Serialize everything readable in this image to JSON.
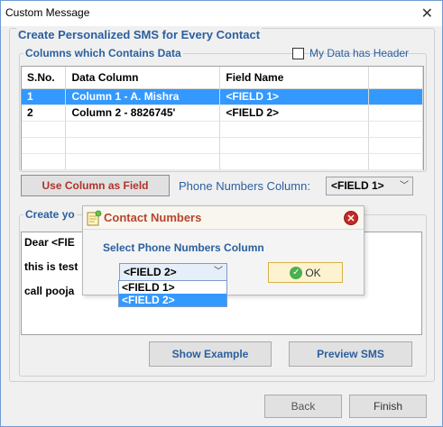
{
  "window": {
    "title": "Custom Message",
    "close_glyph": "✕"
  },
  "main_group": {
    "legend": "Create Personalized SMS for Every Contact"
  },
  "columns_group": {
    "legend": "Columns which Contains Data",
    "header_checkbox_label": "My Data has Header",
    "header_checked": false,
    "table": {
      "headers": [
        "S.No.",
        "Data Column",
        "Field Name"
      ],
      "rows": [
        {
          "sno": "1",
          "data_column": "Column 1 - A. Mishra",
          "field_name": "<FIELD 1>",
          "selected": true
        },
        {
          "sno": "2",
          "data_column": "Column 2 - 8826745'",
          "field_name": "<FIELD 2>",
          "selected": false
        }
      ]
    }
  },
  "use_column_button": "Use Column as Field",
  "phone_numbers": {
    "label": "Phone Numbers Column:",
    "selected": "<FIELD 1>"
  },
  "create_group": {
    "legend": "Create yo",
    "message_lines": [
      "Dear <FIE",
      "this is test",
      "call pooja"
    ]
  },
  "buttons": {
    "show_example": "Show Example",
    "preview_sms": "Preview SMS",
    "back": "Back",
    "finish": "Finish"
  },
  "popup": {
    "title": "Contact Numbers",
    "prompt": "Select Phone Numbers Column",
    "selected": "<FIELD 2>",
    "options": [
      "<FIELD 1>",
      "<FIELD 2>"
    ],
    "highlighted_option": "<FIELD 2>",
    "ok_label": "OK"
  },
  "colors": {
    "accent_blue": "#2b5f9e",
    "selection": "#3399ff",
    "popup_title": "#b8452c",
    "use_column_text": "#b0332a"
  },
  "icons": {
    "window_close": "close-icon",
    "popup_app": "notepad-icon",
    "popup_close": "close-circle-icon",
    "ok": "check-circle-icon",
    "dropdown": "chevron-down-icon"
  }
}
